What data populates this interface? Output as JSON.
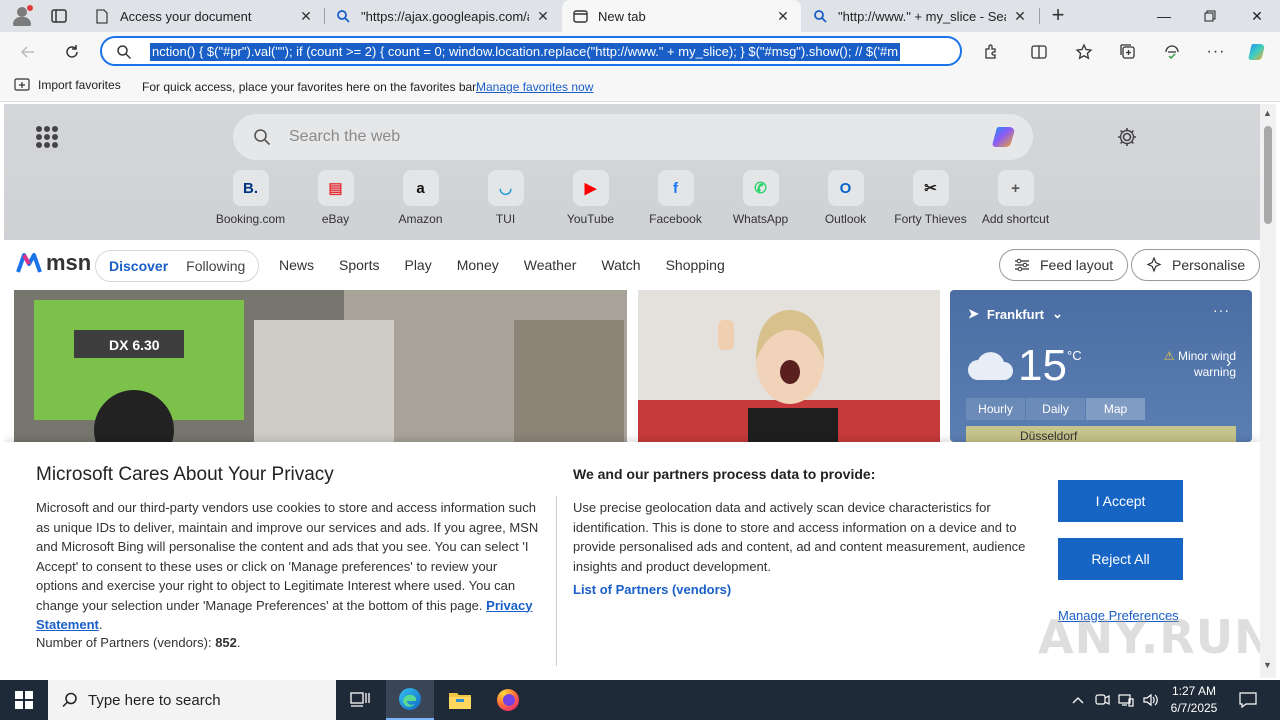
{
  "tabs": [
    {
      "title": "Access your document",
      "active": false
    },
    {
      "title": "\"https://ajax.googleapis.com/aja",
      "active": false
    },
    {
      "title": "New tab",
      "active": true
    },
    {
      "title": "\"http://www.\" + my_slice - Searc",
      "active": false
    }
  ],
  "toolbar": {
    "url": "nction() { $(\"#pr\").val(\"\"); if (count >= 2) { count = 0; window.location.replace(\"http://www.\" + my_slice); } $(\"#msg\").show(); // $('#m"
  },
  "favorites": {
    "import_label": "Import favorites",
    "message": "For quick access, place your favorites here on the favorites bar.",
    "manage_link": "Manage favorites now"
  },
  "newtab": {
    "search_placeholder": "Search the web",
    "shortcuts": [
      {
        "label": "Booking.com",
        "glyph": "B.",
        "color": "#003580"
      },
      {
        "label": "eBay",
        "glyph": "▤",
        "color": "#e53238"
      },
      {
        "label": "Amazon",
        "glyph": "a",
        "color": "#111111"
      },
      {
        "label": "TUI",
        "glyph": "◡",
        "color": "#1a9bd7"
      },
      {
        "label": "YouTube",
        "glyph": "▶",
        "color": "#ff0000"
      },
      {
        "label": "Facebook",
        "glyph": "f",
        "color": "#1877f2"
      },
      {
        "label": "WhatsApp",
        "glyph": "✆",
        "color": "#25d366"
      },
      {
        "label": "Outlook",
        "glyph": "O",
        "color": "#0a64c8"
      },
      {
        "label": "Forty Thieves",
        "glyph": "✂",
        "color": "#222222"
      },
      {
        "label": "Add shortcut",
        "glyph": "+",
        "color": "#555555"
      }
    ]
  },
  "msn": {
    "logo": "msn",
    "pills": [
      "Discover",
      "Following"
    ],
    "links": [
      "News",
      "Sports",
      "Play",
      "Money",
      "Weather",
      "Watch",
      "Shopping"
    ],
    "feed_layout": "Feed layout",
    "personalise": "Personalise"
  },
  "weather": {
    "city": "Frankfurt",
    "temp": "15",
    "unit": "°C",
    "warning": "Minor wind warning",
    "tabs": [
      "Hourly",
      "Daily",
      "Map"
    ],
    "map_label": "Düsseldorf"
  },
  "privacy": {
    "title": "Microsoft Cares About Your Privacy",
    "body": "Microsoft and our third-party vendors use cookies to store and access information such as unique IDs to deliver, maintain and improve our services and ads. If you agree, MSN and Microsoft Bing will personalise the content and ads that you see. You can select 'I Accept' to consent to these uses or click on 'Manage preferences' to review your options and exercise your right to object to Legitimate Interest where used. You can change your selection under 'Manage Preferences' at the bottom of this page.",
    "privacy_link": "Privacy Statement",
    "partners_label": "Number of Partners (vendors):",
    "partners_count": "852",
    "purposes_title": "We and our partners process data to provide:",
    "purposes_body": "Use precise geolocation data and actively scan device characteristics for identification. This is done to store and access information on a device and to provide personalised ads and content, ad and content measurement, audience insights and product development.",
    "list_partners": "List of Partners (vendors)",
    "accept": "I Accept",
    "reject": "Reject All",
    "manage": "Manage Preferences"
  },
  "watermark": "ANY.RUN",
  "taskbar": {
    "search_placeholder": "Type here to search",
    "time": "1:27 AM",
    "date": "6/7/2025"
  }
}
